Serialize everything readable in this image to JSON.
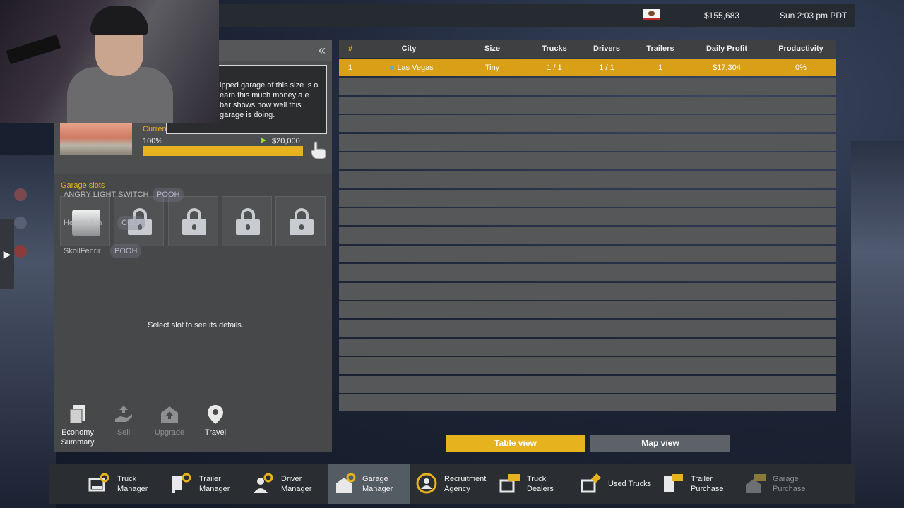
{
  "header": {
    "money": "$155,683",
    "clock": "Sun 2:03 pm PDT"
  },
  "left_panel": {
    "tooltip": "ipped garage of this size is o earn this much money a e bar shows how well this garage is doing.",
    "current_label": "Curren",
    "progress_percent": "100%",
    "progress_fraction": 1.0,
    "target_money": "$20,000",
    "garage_slots_title": "Garage slots",
    "select_hint": "Select slot to see its details.",
    "actions": [
      {
        "label_line1": "Economy",
        "label_line2": "Summary"
      },
      {
        "label_line1": "Sell",
        "label_line2": ""
      },
      {
        "label_line1": "Upgrade",
        "label_line2": ""
      },
      {
        "label_line1": "Travel",
        "label_line2": ""
      }
    ]
  },
  "chat": [
    {
      "name": "ANGRY LIGHT SWITCH",
      "badge": "POOH"
    },
    {
      "name": "Heretic Nin",
      "badge": "CULT"
    },
    {
      "name": "SkollFenrir",
      "badge": "POOH"
    }
  ],
  "table": {
    "headers": [
      "#",
      "City",
      "Size",
      "Trucks",
      "Drivers",
      "Trailers",
      "Daily Profit",
      "Productivity"
    ],
    "rows": [
      {
        "num": "1",
        "city": "Las Vegas",
        "size": "Tiny",
        "trucks": "1 / 1",
        "drivers": "1 / 1",
        "trailers": "1",
        "profit": "$17,304",
        "productivity": "0%"
      }
    ],
    "empty_rows": 18
  },
  "views": {
    "table": "Table view",
    "map": "Map view"
  },
  "nav": [
    {
      "l1": "Truck",
      "l2": "Manager"
    },
    {
      "l1": "Trailer",
      "l2": "Manager"
    },
    {
      "l1": "Driver",
      "l2": "Manager"
    },
    {
      "l1": "Garage",
      "l2": "Manager"
    },
    {
      "l1": "Recruitment",
      "l2": "Agency"
    },
    {
      "l1": "Truck",
      "l2": "Dealers"
    },
    {
      "l1": "Used Trucks",
      "l2": ""
    },
    {
      "l1": "Trailer",
      "l2": "Purchase"
    },
    {
      "l1": "Garage",
      "l2": "Purchase"
    }
  ],
  "colors": {
    "accent": "#e6b31e",
    "panel": "#464849",
    "row": "#555758",
    "selected_row": "#d99f16"
  }
}
